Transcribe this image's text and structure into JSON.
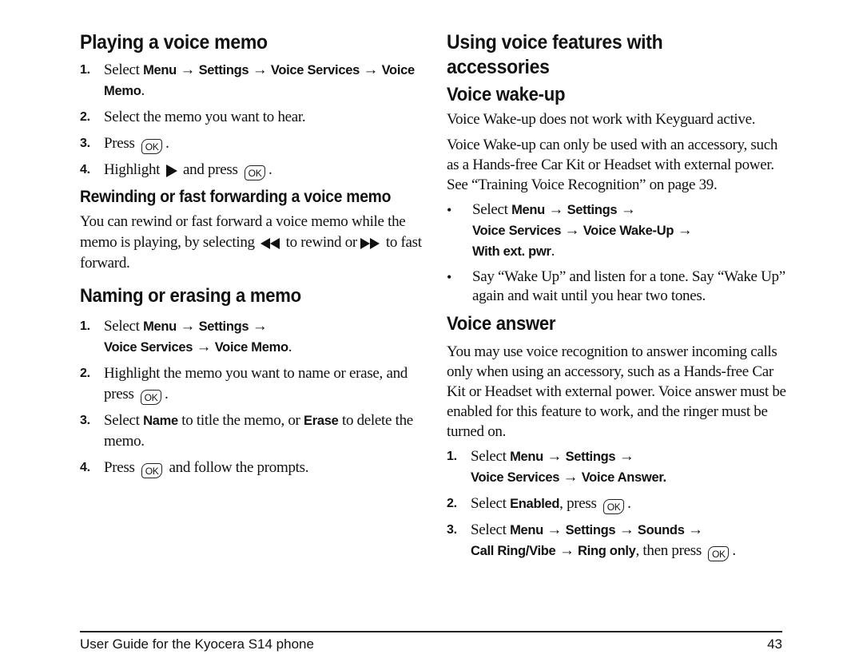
{
  "left": {
    "playing": {
      "title": "Playing a voice memo",
      "step1": {
        "num": "1.",
        "pre": "Select ",
        "p1": "Menu",
        "a1": " → ",
        "p2": "Settings",
        "a2": " → ",
        "p3": "Voice Services",
        "a3": " → ",
        "p4": "Voice Memo",
        "post": "."
      },
      "step2": {
        "num": "2.",
        "text": "Select the memo you want to hear."
      },
      "step3": {
        "num": "3.",
        "pre": "Press",
        "post": "."
      },
      "step4": {
        "num": "4.",
        "pre": "Highlight",
        "mid": "and press",
        "post": "."
      },
      "ok_label": "OK"
    },
    "rewind": {
      "title": "Rewinding or fast forwarding a voice memo",
      "text_pre": "You can rewind or fast forward a voice memo while the memo is playing, by selecting",
      "text_mid": "to rewind or",
      "text_post": "to fast forward."
    },
    "naming": {
      "title": "Naming or erasing a memo",
      "step1": {
        "num": "1.",
        "pre": "Select ",
        "p1": "Menu",
        "a1": " → ",
        "p2": "Settings",
        "a2": " → ",
        "p3": "Voice Services",
        "a3": " → ",
        "p4": "Voice Memo",
        "post": "."
      },
      "step2": {
        "num": "2.",
        "pre": "Highlight the memo you want to name or erase, and press",
        "post": "."
      },
      "step3": {
        "num": "3.",
        "pre": "Select ",
        "b1": "Name",
        "mid": " to title the memo, or ",
        "b2": "Erase",
        "post": " to delete the memo."
      },
      "step4": {
        "num": "4.",
        "pre": "Press",
        "post": "and follow the prompts."
      }
    }
  },
  "right": {
    "title": "Using voice features with accessories",
    "wakeup": {
      "title": "Voice wake-up",
      "para1": "Voice Wake-up does not work with Keyguard active.",
      "para2": "Voice Wake-up can only be used with an accessory, such as a Hands-free Car Kit or Headset with external power. See “Training Voice Recognition” on page 39.",
      "bullet1": {
        "bullet": "•",
        "pre": "Select ",
        "p1": "Menu",
        "a1": " → ",
        "p2": "Settings",
        "a2": " → ",
        "p3": "Voice Services",
        "a3": " → ",
        "p4": "Voice Wake-Up",
        "a4": " → ",
        "p5": "With ext. pwr",
        "post": "."
      },
      "bullet2": {
        "bullet": "•",
        "text": "Say “Wake Up” and listen for a tone. Say “Wake Up” again and wait until you hear two tones."
      }
    },
    "answer": {
      "title": "Voice answer",
      "para": "You may use voice recognition to answer incoming calls only when using an accessory, such as a Hands-free Car Kit or Headset with external power. Voice answer must be enabled for this feature to work, and the ringer must be turned on.",
      "step1": {
        "num": "1.",
        "pre": "Select ",
        "p1": "Menu",
        "a1": " → ",
        "p2": "Settings",
        "a2": " → ",
        "p3": "Voice Services",
        "a3": " → ",
        "p4": "Voice Answer."
      },
      "step2": {
        "num": "2.",
        "pre": "Select ",
        "b1": "Enabled",
        "mid": ", press",
        "post": "."
      },
      "step3": {
        "num": "3.",
        "pre": "Select ",
        "p1": "Menu",
        "a1": " → ",
        "p2": "Settings",
        "a2": " → ",
        "p3": "Sounds",
        "a3": " → ",
        "p4": "Call Ring/Vibe",
        "a4": " → ",
        "p5": "Ring only",
        "mid": ", then press",
        "post": "."
      }
    }
  },
  "footer": {
    "guide_title": "User Guide for the Kyocera S14 phone",
    "page_number": "43"
  }
}
